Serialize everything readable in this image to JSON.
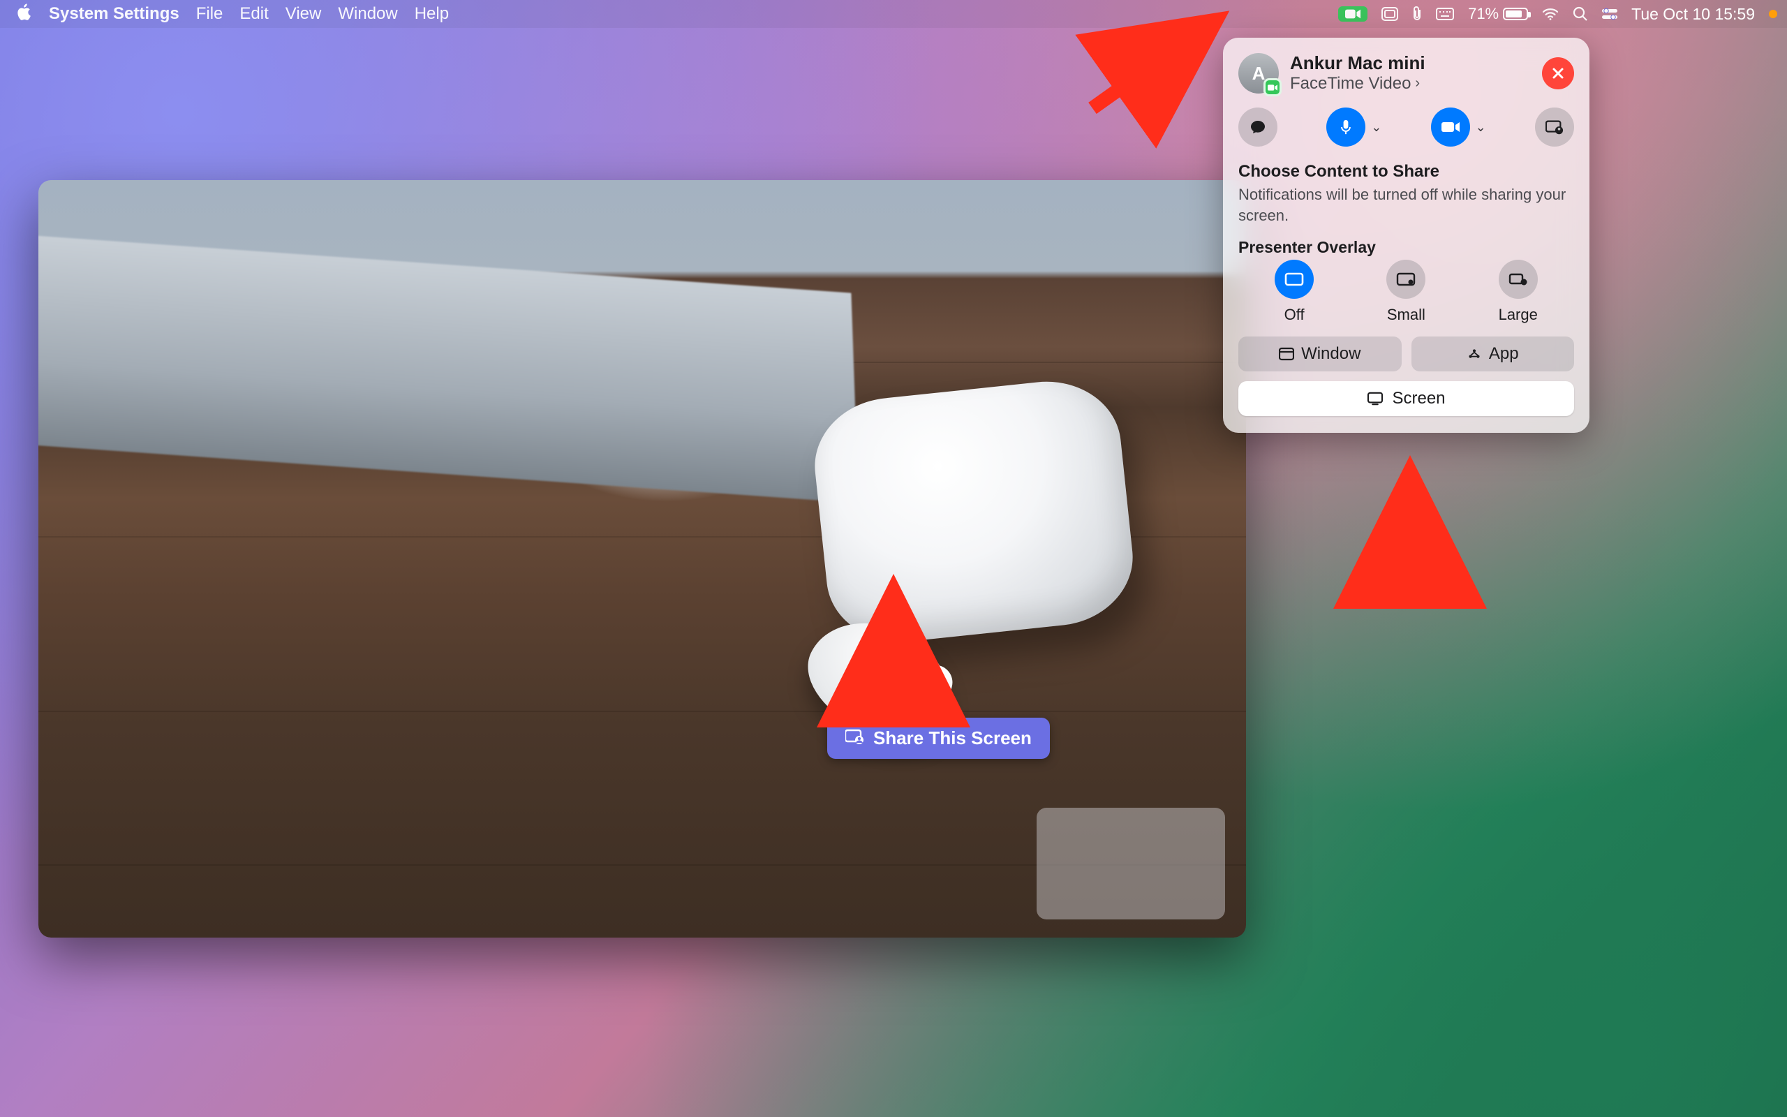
{
  "menubar": {
    "app": "System Settings",
    "items": [
      "File",
      "Edit",
      "View",
      "Window",
      "Help"
    ],
    "battery_percent": "71%",
    "clock": "Tue Oct 10  15:59"
  },
  "facetime_window": {
    "share_button_label": "Share This Screen"
  },
  "popover": {
    "avatar_initial": "A",
    "caller_name": "Ankur Mac mini",
    "call_type": "FaceTime Video",
    "choose_title": "Choose Content to Share",
    "choose_subtitle": "Notifications will be turned off while sharing your screen.",
    "presenter_overlay_title": "Presenter Overlay",
    "overlay_options": {
      "off": "Off",
      "small": "Small",
      "large": "Large"
    },
    "window_label": "Window",
    "app_label": "App",
    "screen_label": "Screen"
  }
}
